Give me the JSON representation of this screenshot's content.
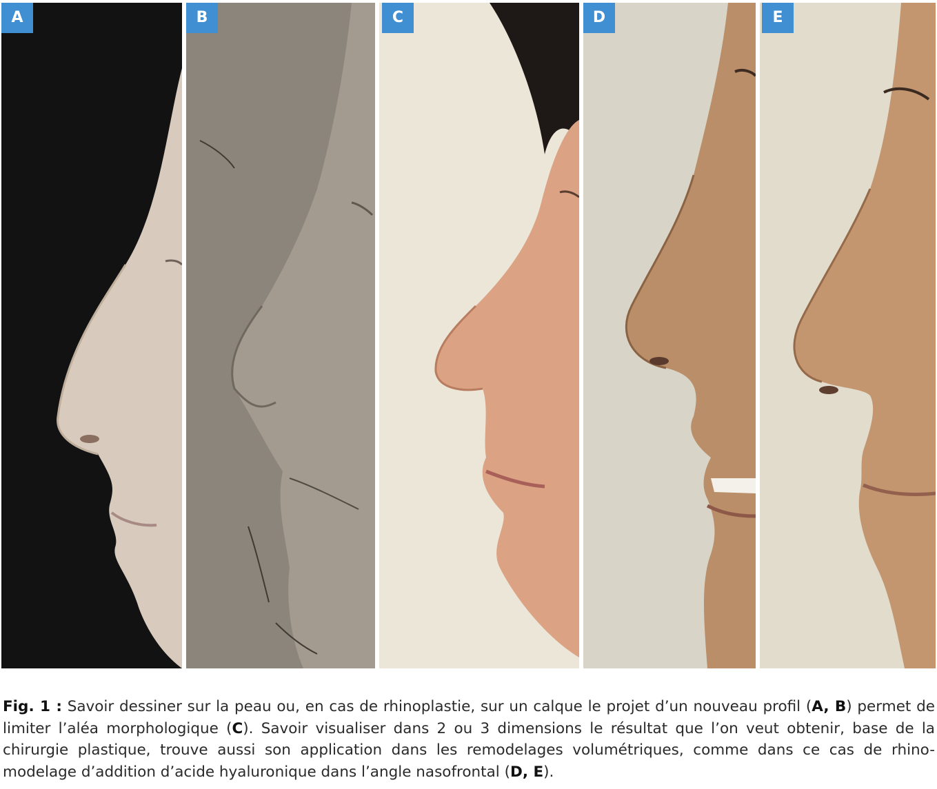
{
  "panels": [
    {
      "label": "A"
    },
    {
      "label": "B"
    },
    {
      "label": "C"
    },
    {
      "label": "D"
    },
    {
      "label": "E"
    }
  ],
  "caption": {
    "fig_label": "Fig. 1 :",
    "part1": " Savoir dessiner sur la peau ou, en cas de rhinoplastie, sur un calque le projet d’un nouveau profil (",
    "ref1": "A, B",
    "part2": ") permet de limiter l’aléa morphologique (",
    "ref2": "C",
    "part3": "). Savoir visualiser dans 2 ou 3 dimensions le résultat que l’on veut obtenir, base de la chirurgie plastique, trouve aussi son application dans les remodelages volumétriques, comme dans ce cas de rhino-modelage d’addition d’acide hyaluronique dans l’angle nasofrontal (",
    "ref3": "D, E",
    "part4": ")."
  },
  "colors": {
    "badge": "#3f8fd2",
    "panel_a_bg": "#121212",
    "panel_b_bg": "#8c857b",
    "panel_c_bg": "#ece6d8",
    "panel_d_bg": "#d9d4c8",
    "panel_e_bg": "#e2dccd"
  }
}
